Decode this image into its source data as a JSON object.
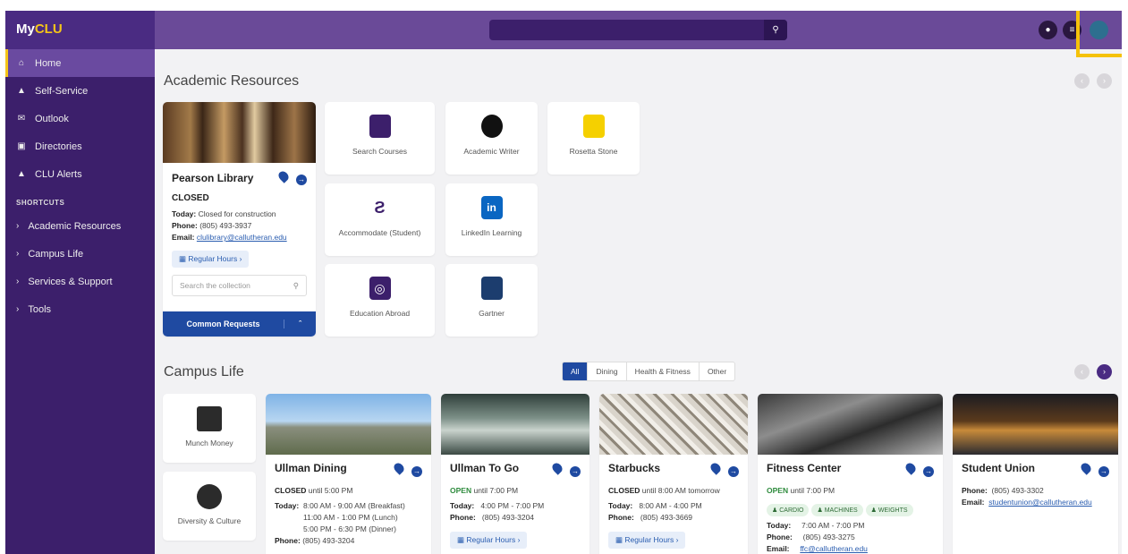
{
  "app": {
    "logo_my": "My",
    "logo_clu": "CLU"
  },
  "sidebar": {
    "items": [
      {
        "label": "Home",
        "icon": "home-icon"
      },
      {
        "label": "Self-Service",
        "icon": "graduation-icon"
      },
      {
        "label": "Outlook",
        "icon": "mail-icon"
      },
      {
        "label": "Directories",
        "icon": "contact-book-icon"
      },
      {
        "label": "CLU Alerts",
        "icon": "warning-icon"
      }
    ],
    "shortcuts_heading": "SHORTCUTS",
    "shortcuts": [
      "Academic Resources",
      "Campus Life",
      "Services & Support",
      "Tools"
    ]
  },
  "academic": {
    "title": "Academic Resources",
    "library": {
      "name": "Pearson Library",
      "status": "CLOSED",
      "today_label": "Today:",
      "today_value": "Closed for construction",
      "phone_label": "Phone:",
      "phone_value": "(805) 493-3937",
      "email_label": "Email:",
      "email_value": "clulibrary@callutheran.edu",
      "hours_btn": "Regular Hours",
      "search_placeholder": "Search the collection",
      "requests_btn": "Common Requests"
    },
    "tiles": [
      {
        "label": "Search Courses",
        "icon": "search-document-icon",
        "color": "#3c1f6b"
      },
      {
        "label": "Academic Writer",
        "icon": "academic-writer-icon",
        "color": "#111111"
      },
      {
        "label": "Rosetta Stone",
        "icon": "rosetta-stone-icon",
        "color": "#f5d000"
      },
      {
        "label": "Accommodate (Student)",
        "icon": "accommodate-icon",
        "color": "#3c1f6b"
      },
      {
        "label": "LinkedIn Learning",
        "icon": "linkedin-icon",
        "color": "#0a66c2"
      },
      {
        "label": "Education Abroad",
        "icon": "globe-icon",
        "color": "#3c1f6b"
      },
      {
        "label": "Gartner",
        "icon": "gartner-icon",
        "color": "#1c3d6e"
      }
    ]
  },
  "campus": {
    "title": "Campus Life",
    "filters": [
      "All",
      "Dining",
      "Health & Fitness",
      "Other"
    ],
    "munch": {
      "label": "Munch Money",
      "icon": "munch-money-icon"
    },
    "diversity": {
      "label": "Diversity & Culture",
      "icon": "globe-icon"
    },
    "ullman": {
      "name": "Ullman Dining",
      "status": "CLOSED",
      "until": "until 5:00 PM",
      "today_label": "Today:",
      "h1": "8:00 AM - 9:00 AM (Breakfast)",
      "h2": "11:00 AM - 1:00 PM (Lunch)",
      "h3": "5:00 PM - 6:30 PM (Dinner)",
      "phone_label": "Phone:",
      "phone_value": "(805) 493-3204"
    },
    "togo": {
      "name": "Ullman To Go",
      "status": "OPEN",
      "until": "until 7:00 PM",
      "today_label": "Today:",
      "today_value": "4:00 PM - 7:00 PM",
      "phone_label": "Phone:",
      "phone_value": "(805) 493-3204",
      "hours_btn": "Regular Hours"
    },
    "starbucks": {
      "name": "Starbucks",
      "status": "CLOSED",
      "until": "until 8:00 AM tomorrow",
      "today_label": "Today:",
      "today_value": "8:00 AM - 4:00 PM",
      "phone_label": "Phone:",
      "phone_value": "(805) 493-3669",
      "hours_btn": "Regular Hours"
    },
    "fitness": {
      "name": "Fitness Center",
      "status": "OPEN",
      "until": "until 7:00 PM",
      "tags": [
        "CARDIO",
        "MACHINES",
        "WEIGHTS"
      ],
      "today_label": "Today:",
      "today_value": "7:00 AM - 7:00 PM",
      "phone_label": "Phone:",
      "phone_value": "(805) 493-3275",
      "email_label": "Email:",
      "email_value": "ffc@callutheran.edu"
    },
    "union": {
      "name": "Student Union",
      "phone_label": "Phone:",
      "phone_value": "(805) 493-3302",
      "email_label": "Email:",
      "email_value": "studentunion@callutheran.edu"
    }
  },
  "colors": {
    "brand": "#3c1f6b",
    "accent": "#f5c518",
    "link": "#1f4aa1"
  }
}
